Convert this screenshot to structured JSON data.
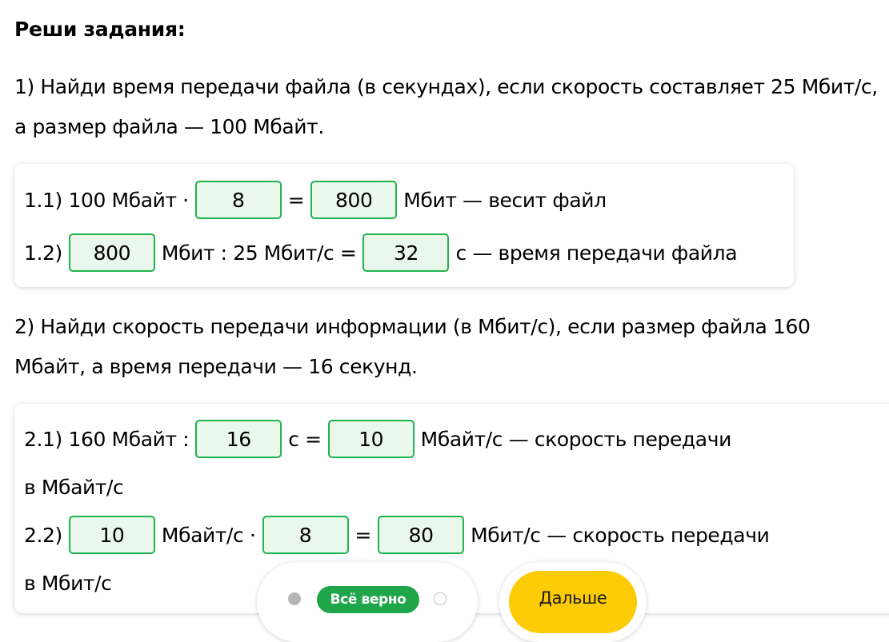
{
  "title": "Реши задания:",
  "task1": {
    "text": "1) Найди время передачи файла (в секундах), если скорость составляет 25 Мбит/с, а размер файла — 100 Мбайт.",
    "step1": {
      "prefix": "1.1) 100 Мбайт ·",
      "box1": "8",
      "mid": "=",
      "box2": "800",
      "suffix": "Мбит — весит файл"
    },
    "step2": {
      "prefix": "1.2)",
      "box1": "800",
      "mid": "Мбит : 25 Мбит/с =",
      "box2": "32",
      "suffix": "с — время передачи файла"
    }
  },
  "task2": {
    "text": "2) Найди скорость передачи информации (в Мбит/с), если размер файла 160 Мбайт, а время передачи — 16 секунд.",
    "step1": {
      "prefix": "2.1) 160 Мбайт :",
      "box1": "16",
      "mid": "с =",
      "box2": "10",
      "suffix": "Мбайт/с — скорость передачи",
      "cont": "в Мбайт/с"
    },
    "step2": {
      "prefix": "2.2)",
      "box1": "10",
      "mid": "Мбайт/с ·",
      "box2": "8",
      "mid2": "=",
      "box3": "80",
      "suffix": "Мбит/с — скорость передачи",
      "cont": "в Мбит/с"
    }
  },
  "footer": {
    "status_badge": "Всё верно",
    "next_label": "Дальше"
  },
  "colors": {
    "answer_border": "#21b34f",
    "answer_fill": "#e9f8ea",
    "badge": "#1fa54a",
    "next_button": "#fdcc07"
  }
}
